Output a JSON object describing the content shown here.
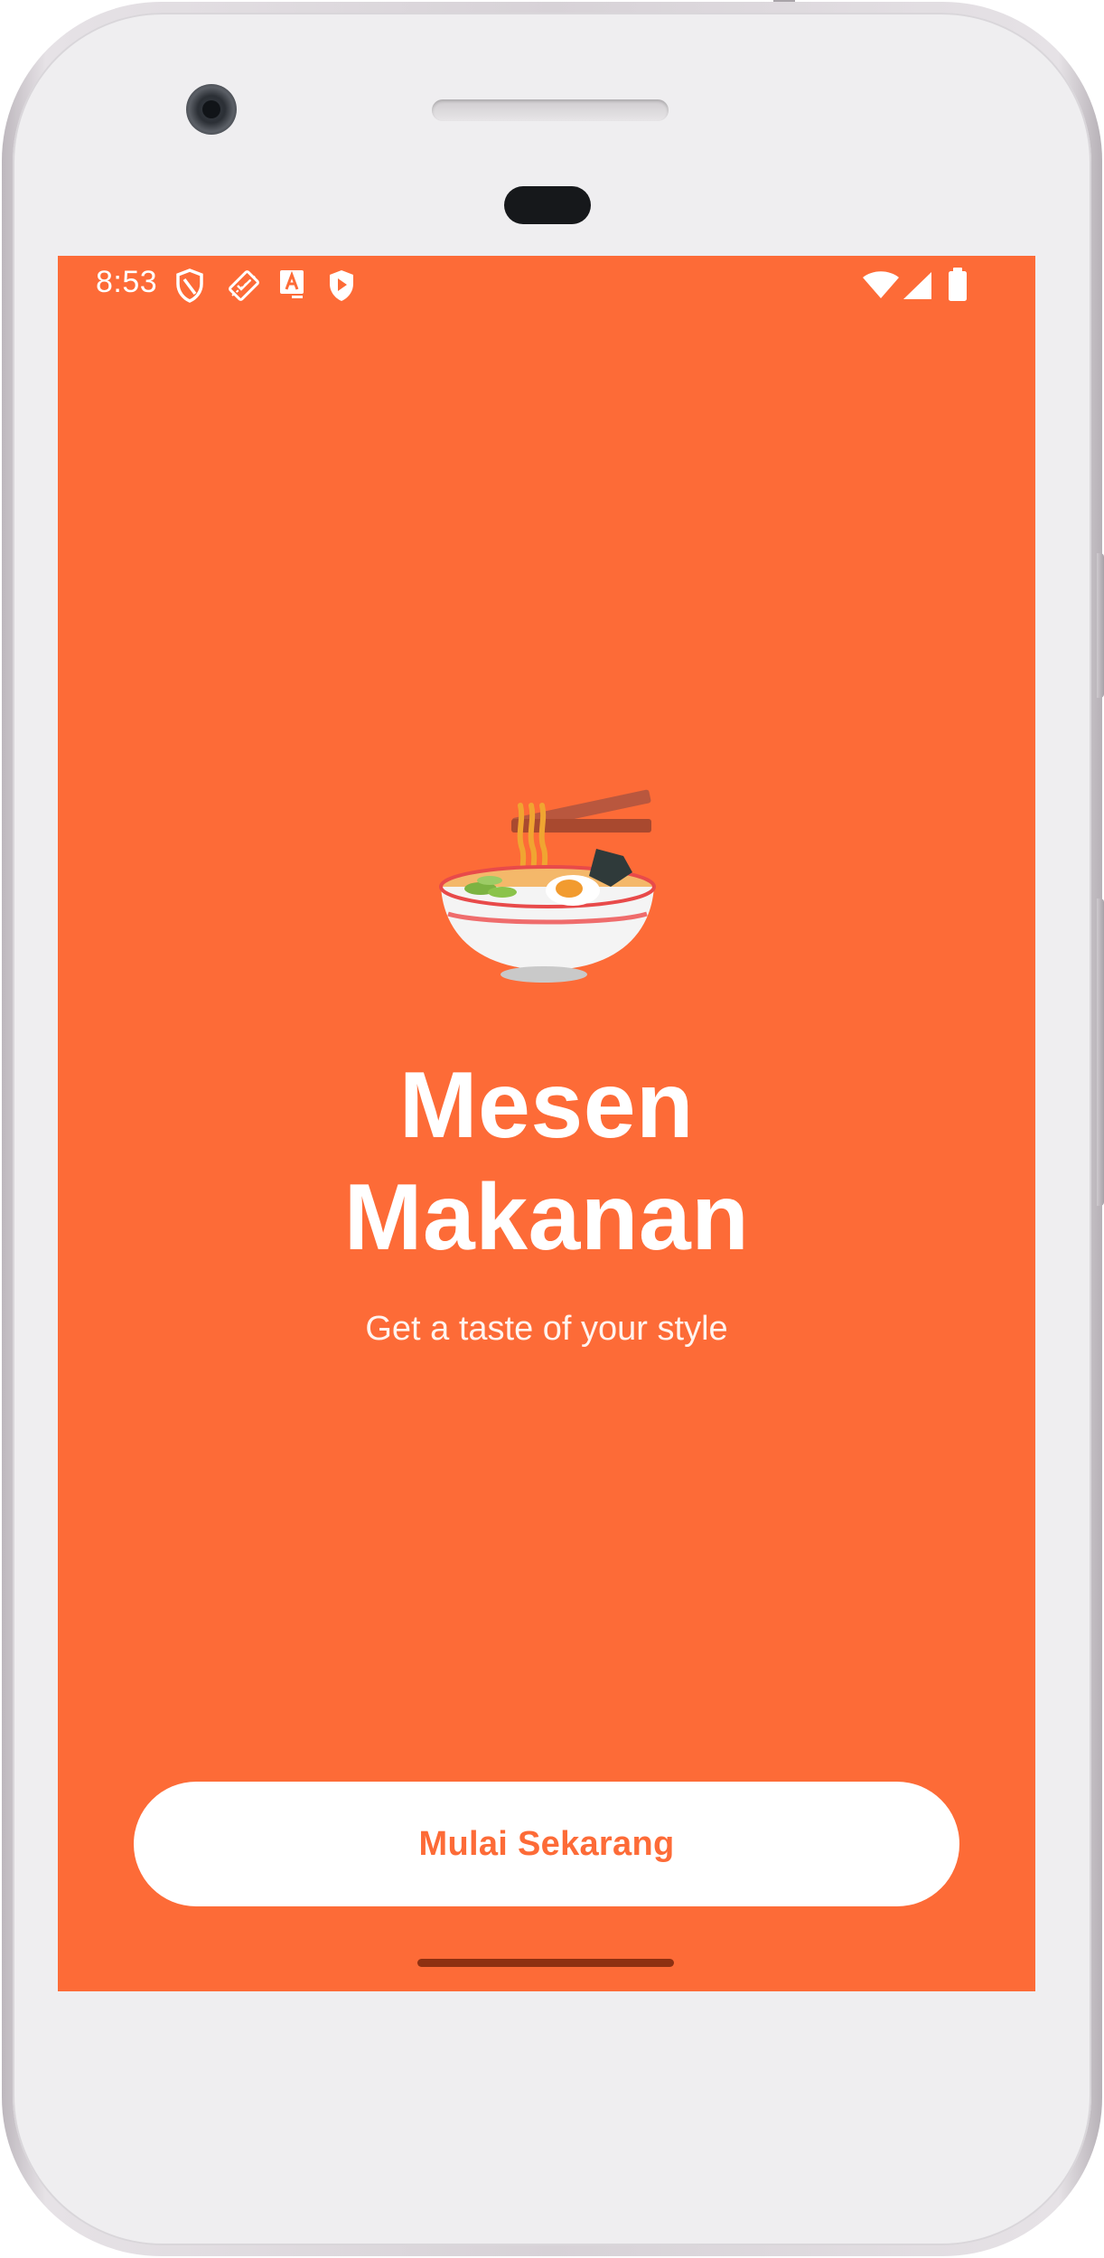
{
  "status_bar": {
    "time": "8:53",
    "left_icons": [
      "shield-outline-icon",
      "developer-mode-icon",
      "text-a-icon",
      "play-shield-icon"
    ],
    "right_icons": [
      "wifi-icon",
      "cell-signal-icon",
      "battery-icon"
    ]
  },
  "splash": {
    "illustration": "ramen-bowl-icon",
    "title_line1": "Mesen",
    "title_line2": "Makanan",
    "tagline": "Get a taste of your style",
    "start_label": "Mulai Sekarang"
  },
  "colors": {
    "background": "#fd6b37",
    "button_background": "#ffffff",
    "button_text": "#fd6b37",
    "text": "#ffffff",
    "gesture_bar": "#8e3011"
  }
}
